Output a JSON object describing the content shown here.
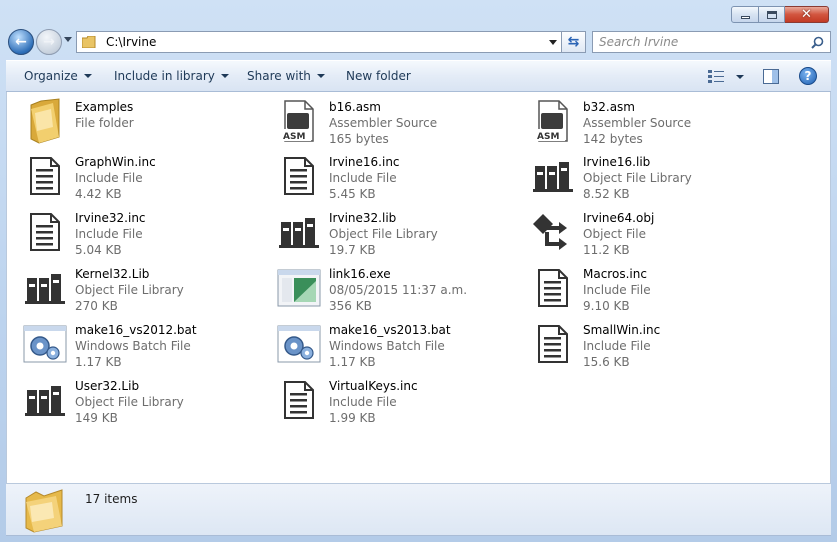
{
  "window": {
    "controls": {
      "minimize": "minimize",
      "maximize": "maximize",
      "close": "✕"
    }
  },
  "nav": {
    "address": "C:\\Irvine",
    "search_placeholder": "Search Irvine"
  },
  "toolbar": {
    "organize": "Organize",
    "include_in_library": "Include in library",
    "share_with": "Share with",
    "new_folder": "New folder",
    "help": "?"
  },
  "files": [
    {
      "name": "Examples",
      "type": "File folder",
      "detail": "",
      "icon": "folder-icon"
    },
    {
      "name": "b16.asm",
      "type": "Assembler Source",
      "detail": "165 bytes",
      "icon": "asm-icon"
    },
    {
      "name": "b32.asm",
      "type": "Assembler Source",
      "detail": "142 bytes",
      "icon": "asm-icon"
    },
    {
      "name": "GraphWin.inc",
      "type": "Include File",
      "detail": "4.42 KB",
      "icon": "document-icon"
    },
    {
      "name": "Irvine16.inc",
      "type": "Include File",
      "detail": "5.45 KB",
      "icon": "document-icon"
    },
    {
      "name": "Irvine16.lib",
      "type": "Object File Library",
      "detail": "8.52 KB",
      "icon": "library-icon"
    },
    {
      "name": "Irvine32.inc",
      "type": "Include File",
      "detail": "5.04 KB",
      "icon": "document-icon"
    },
    {
      "name": "Irvine32.lib",
      "type": "Object File Library",
      "detail": "19.7 KB",
      "icon": "library-icon"
    },
    {
      "name": "Irvine64.obj",
      "type": "Object File",
      "detail": "11.2 KB",
      "icon": "object-icon"
    },
    {
      "name": "Kernel32.Lib",
      "type": "Object File Library",
      "detail": "270 KB",
      "icon": "library-icon"
    },
    {
      "name": "link16.exe",
      "type": "08/05/2015 11:37 a.m.",
      "detail": "356 KB",
      "icon": "exe-icon"
    },
    {
      "name": "Macros.inc",
      "type": "Include File",
      "detail": "9.10 KB",
      "icon": "document-icon"
    },
    {
      "name": "make16_vs2012.bat",
      "type": "Windows Batch File",
      "detail": "1.17 KB",
      "icon": "batch-icon"
    },
    {
      "name": "make16_vs2013.bat",
      "type": "Windows Batch File",
      "detail": "1.17 KB",
      "icon": "batch-icon"
    },
    {
      "name": "SmallWin.inc",
      "type": "Include File",
      "detail": "15.6 KB",
      "icon": "document-icon"
    },
    {
      "name": "User32.Lib",
      "type": "Object File Library",
      "detail": "149 KB",
      "icon": "library-icon"
    },
    {
      "name": "VirtualKeys.inc",
      "type": "Include File",
      "detail": "1.99 KB",
      "icon": "document-icon"
    }
  ],
  "status": {
    "count": "17 items"
  },
  "colors": {
    "accent": "#2f6fb8",
    "window_bg": "#bcd3ee",
    "close": "#c23a24"
  }
}
